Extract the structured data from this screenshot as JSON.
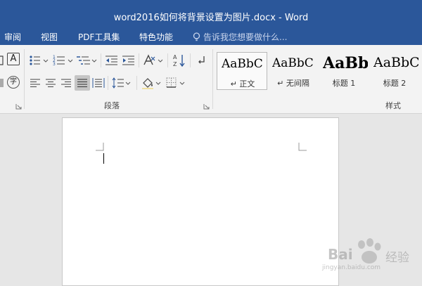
{
  "window": {
    "title": "word2016如何将背景设置为图片.docx - Word"
  },
  "tabs": [
    {
      "label": "审阅"
    },
    {
      "label": "视图"
    },
    {
      "label": "PDF工具集"
    },
    {
      "label": "特色功能"
    }
  ],
  "tell_me": {
    "placeholder": "告诉我您想要做什么..."
  },
  "ribbon": {
    "font_partial_label": "A",
    "phonetic_label": "字",
    "paragraph_group_label": "段落",
    "styles_group_label": "样式",
    "styles": [
      {
        "sample": "AaBbC",
        "name": "正文",
        "mark": "↵"
      },
      {
        "sample": "AaBbC",
        "name": "无间隔",
        "mark": "↵"
      },
      {
        "sample": "AaBb",
        "name": "标题 1"
      },
      {
        "sample": "AaBbC",
        "name": "标题 2"
      }
    ]
  },
  "watermark": {
    "brand": "Bai",
    "brand2": "经验",
    "url": "jingyan.baidu.com"
  }
}
